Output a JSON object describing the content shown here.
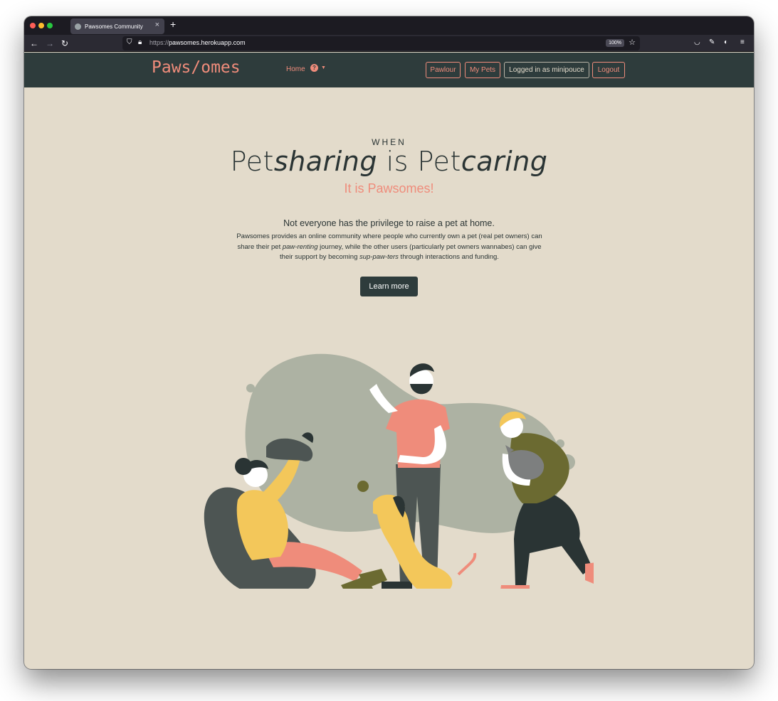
{
  "browser": {
    "tab_title": "Pawsomes Community",
    "url_prefix": "https://",
    "url_host": "pawsomes.herokuapp.com",
    "zoom": "100%"
  },
  "header": {
    "logo": "Paws/omes",
    "nav": {
      "home": "Home"
    },
    "buttons": {
      "pawlour": "Pawlour",
      "my_pets": "My Pets",
      "logged_in": "Logged in as minipouce",
      "logout": "Logout"
    }
  },
  "hero": {
    "when": "WHEN",
    "headline": {
      "pet1": "Pet",
      "sharing": "sharing",
      "is": " is ",
      "pet2": "Pet",
      "caring": "caring"
    },
    "tagline": "It is Pawsomes!",
    "lead": "Not everyone has the privilege to raise a pet at home.",
    "body": {
      "p1": "Pawsomes provides an online community where people who currently own a pet (real pet owners) can share their pet ",
      "em1": "paw-renting",
      "p2": " journey, while the other users (particularly pet owners wannabes) can give their support by becoming ",
      "em2": "sup-paw-ters",
      "p3": " through interactions and funding."
    },
    "cta": "Learn more"
  },
  "colors": {
    "accent": "#ef8c7b",
    "dark": "#2e3c3c",
    "background": "#e3dbcb",
    "blob": "#adb2a3"
  },
  "icons": [
    "back-icon",
    "forward-icon",
    "reload-icon",
    "shield-icon",
    "lock-icon",
    "star-icon",
    "pocket-icon",
    "wrench-icon",
    "extension-icon",
    "menu-icon",
    "help-icon",
    "chevron-down-icon"
  ]
}
